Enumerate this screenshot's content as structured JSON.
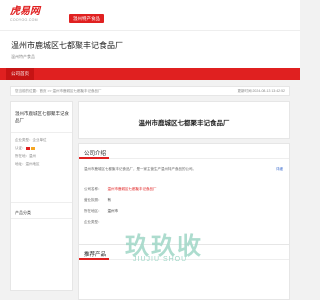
{
  "site": {
    "logo_main": "虎易网",
    "logo_sub": "COOYOO.COM",
    "tag": "温州特产食品"
  },
  "company": {
    "name": "温州市鹿城区七都聚丰记食品厂",
    "subtitle": "温州特产食品"
  },
  "nav": {
    "items": [
      "公司首页"
    ]
  },
  "breadcrumb": {
    "path": "您当前的位置：首页 >> 温州市鹿城区七都聚丰记食品厂",
    "time": "更新时间:2024-08-13 13:42:52"
  },
  "sidebar": {
    "company_name": "温州市鹿城区七都聚丰记食品厂",
    "rows": [
      {
        "label": "企业类型：",
        "value": "企业单位"
      },
      {
        "label": "认证：",
        "value": "企业认证 营业执照"
      },
      {
        "label": "所在地：",
        "value": "温州"
      },
      {
        "label": "地址：",
        "value": "温州地区"
      }
    ],
    "products_title": "产品分类"
  },
  "main": {
    "title": "温州市鹿城区七都聚丰记食品厂",
    "intro_section": "公司介绍",
    "intro_text": "温州市鹿城区七都聚丰记食品厂，是一家主营生产温州特产食品的公司。",
    "more": "详细",
    "info": [
      {
        "label": "公司名称：",
        "value": "温州市鹿城区七都聚丰记食品厂",
        "red": true
      },
      {
        "label": "营业执照：",
        "value": "有",
        "red": false
      },
      {
        "label": "所在地区：",
        "value": "温州市",
        "red": false
      },
      {
        "label": "企业类型：",
        "value": "",
        "red": false
      }
    ],
    "stats": [
      {
        "num": "0",
        "label": "人浏览"
      },
      {
        "num": "0",
        "label": "次更新"
      },
      {
        "num": "0",
        "label": "条产品信息"
      }
    ],
    "products_section": "推荐产品"
  },
  "watermark": {
    "main": "玖玖收",
    "sub": "JIUJIU SHOU"
  },
  "colors": {
    "brand": "#e02020",
    "link": "#3366cc"
  }
}
